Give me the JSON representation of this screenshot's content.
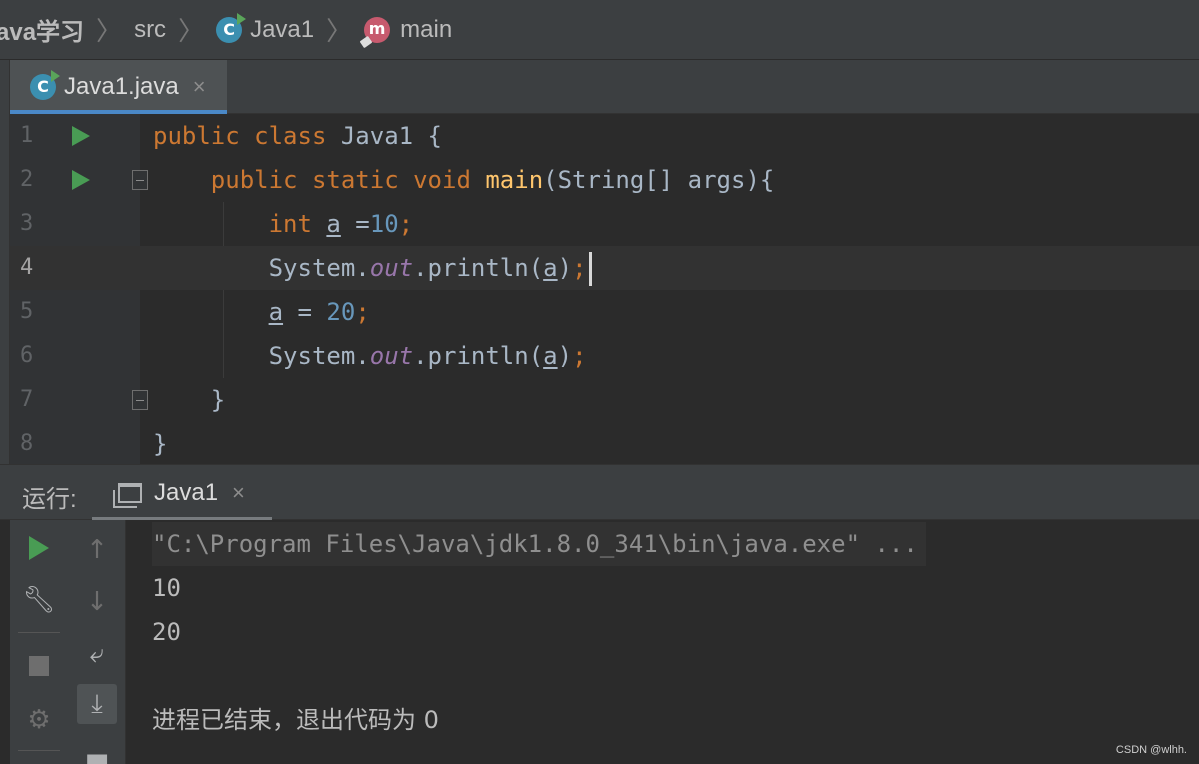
{
  "breadcrumb": {
    "root": "ava学习",
    "items": [
      "src",
      "Java1",
      "main"
    ],
    "icons": [
      "class-icon",
      "method-icon"
    ]
  },
  "editor_tab": {
    "label": "Java1.java",
    "close": "×"
  },
  "code": {
    "line_numbers": [
      "1",
      "2",
      "3",
      "4",
      "5",
      "6",
      "7",
      "8"
    ],
    "current_line": "4",
    "lines": [
      {
        "num": "1",
        "tokens": [
          [
            "kw",
            "public "
          ],
          [
            "kw",
            "class "
          ],
          [
            "p",
            "Java1 {"
          ]
        ]
      },
      {
        "num": "2",
        "tokens": [
          [
            "p",
            "    "
          ],
          [
            "kw",
            "public "
          ],
          [
            "kw",
            "static "
          ],
          [
            "kw",
            "void "
          ],
          [
            "fn",
            "main"
          ],
          [
            "p",
            "(String[] args){"
          ]
        ]
      },
      {
        "num": "3",
        "tokens": [
          [
            "p",
            "        "
          ],
          [
            "kw",
            "int "
          ],
          [
            "var",
            "a"
          ],
          [
            "p",
            " ="
          ],
          [
            "num",
            "10"
          ],
          [
            "kw",
            ";"
          ]
        ]
      },
      {
        "num": "4",
        "tokens": [
          [
            "p",
            "        System."
          ],
          [
            "fld",
            "out"
          ],
          [
            "p",
            ".println("
          ],
          [
            "var",
            "a"
          ],
          [
            "p",
            ")"
          ],
          [
            "kw",
            ";"
          ]
        ]
      },
      {
        "num": "5",
        "tokens": [
          [
            "p",
            "        "
          ],
          [
            "var",
            "a"
          ],
          [
            "p",
            " = "
          ],
          [
            "num",
            "20"
          ],
          [
            "kw",
            ";"
          ]
        ]
      },
      {
        "num": "6",
        "tokens": [
          [
            "p",
            "        System."
          ],
          [
            "fld",
            "out"
          ],
          [
            "p",
            ".println("
          ],
          [
            "var",
            "a"
          ],
          [
            "p",
            ")"
          ],
          [
            "kw",
            ";"
          ]
        ]
      },
      {
        "num": "7",
        "tokens": [
          [
            "p",
            "    }"
          ]
        ]
      },
      {
        "num": "8",
        "tokens": [
          [
            "p",
            "}"
          ]
        ]
      }
    ]
  },
  "run_panel": {
    "label": "运行:",
    "tab_label": "Java1",
    "tab_close": "×"
  },
  "console": {
    "command": "\"C:\\Program Files\\Java\\jdk1.8.0_341\\bin\\java.exe\" ...",
    "outputs": [
      "10",
      "20"
    ],
    "exit_message": "进程已结束，退出代码为 0"
  },
  "watermark": "CSDN @wlhh.",
  "colors": {
    "keyword": "#cc7832",
    "function": "#ffc66d",
    "number": "#6897bb",
    "field": "#9876aa",
    "run_green": "#499c54",
    "tab_underline": "#4a88c7"
  }
}
